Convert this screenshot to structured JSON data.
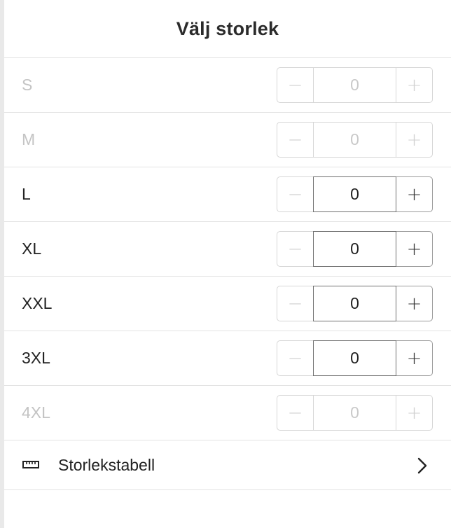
{
  "header": {
    "title": "Välj storlek"
  },
  "sizes": [
    {
      "label": "S",
      "quantity": "0",
      "enabled": false
    },
    {
      "label": "M",
      "quantity": "0",
      "enabled": false
    },
    {
      "label": "L",
      "quantity": "0",
      "enabled": true
    },
    {
      "label": "XL",
      "quantity": "0",
      "enabled": true
    },
    {
      "label": "XXL",
      "quantity": "0",
      "enabled": true
    },
    {
      "label": "3XL",
      "quantity": "0",
      "enabled": true
    },
    {
      "label": "4XL",
      "quantity": "0",
      "enabled": false
    }
  ],
  "stepper": {
    "minus_symbol": "−",
    "plus_symbol": "+"
  },
  "size_chart": {
    "label": "Storlekstabell",
    "icon": "ruler-icon",
    "chevron": "chevron-right-icon"
  },
  "colors": {
    "text": "#222222",
    "disabled_text": "#c4c4c4",
    "divider": "#e3e3e3"
  }
}
